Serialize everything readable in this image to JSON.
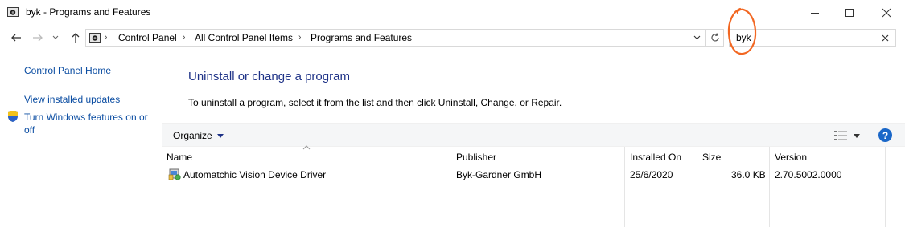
{
  "window": {
    "title": "byk - Programs and Features",
    "minimize_icon": "minimize-icon",
    "maximize_icon": "maximize-icon",
    "close_icon": "close-icon"
  },
  "nav": {
    "back_icon": "arrow-left-icon",
    "forward_icon": "arrow-right-icon",
    "recent_icon": "chevron-down-icon",
    "up_icon": "arrow-up-icon"
  },
  "address": {
    "breadcrumbs": [
      "Control Panel",
      "All Control Panel Items",
      "Programs and Features"
    ]
  },
  "search": {
    "value": "byk"
  },
  "sidebar": {
    "home": "Control Panel Home",
    "updates": "View installed updates",
    "features": "Turn Windows features on or off"
  },
  "main": {
    "title": "Uninstall or change a program",
    "description": "To uninstall a program, select it from the list and then click Uninstall, Change, or Repair."
  },
  "toolbar": {
    "organize": "Organize",
    "help": "?"
  },
  "table": {
    "columns": [
      "Name",
      "Publisher",
      "Installed On",
      "Size",
      "Version"
    ],
    "rows": [
      {
        "name": "Automatchic Vision Device Driver",
        "publisher": "Byk-Gardner GmbH",
        "installed_on": "25/6/2020",
        "size": "36.0 KB",
        "version": "2.70.5002.0000"
      }
    ]
  },
  "colors": {
    "link": "#0b4da2",
    "heading": "#1e3287",
    "annotation": "#f26722",
    "help": "#1a67c8"
  }
}
